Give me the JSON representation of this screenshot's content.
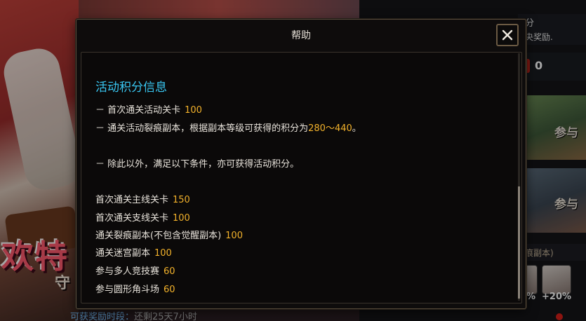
{
  "background": {
    "event_title": "欢特",
    "event_sub": "守",
    "right_panel": {
      "line1": "分",
      "line2": "央奖励.",
      "count": "0",
      "join1": "参与",
      "join2": "参与",
      "bar_text": "痕副本)",
      "pct1": "%",
      "pct2": "+20%"
    },
    "bottom_label": "可获奖励时段：",
    "bottom_value": "还剩25天7小时"
  },
  "help_dialog": {
    "title": "帮助",
    "close_icon": "close-icon",
    "section_title": "活动积分信息",
    "lines": [
      {
        "text": "－ 首次通关活动关卡",
        "value": "100",
        "suffix": ""
      },
      {
        "text": "－ 通关活动裂痕副本，根据副本等级可获得的积分为",
        "value": "280～440",
        "suffix": "。"
      },
      {
        "text": "－ 除此以外，满足以下条件，亦可获得活动积分。",
        "value": "",
        "suffix": ""
      },
      {
        "text": "首次通关主线关卡",
        "value": "150",
        "suffix": ""
      },
      {
        "text": "首次通关支线关卡",
        "value": "100",
        "suffix": ""
      },
      {
        "text": "通关裂痕副本(不包含觉醒副本)",
        "value": "100",
        "suffix": ""
      },
      {
        "text": "通关迷宫副本",
        "value": "100",
        "suffix": ""
      },
      {
        "text": "参与多人竞技赛",
        "value": "60",
        "suffix": ""
      },
      {
        "text": "参与圆形角斗场",
        "value": "60",
        "suffix": ""
      }
    ]
  },
  "colors": {
    "highlight": "#f3b22b",
    "section_title": "#39c7f2",
    "text": "#e9e4dc"
  }
}
